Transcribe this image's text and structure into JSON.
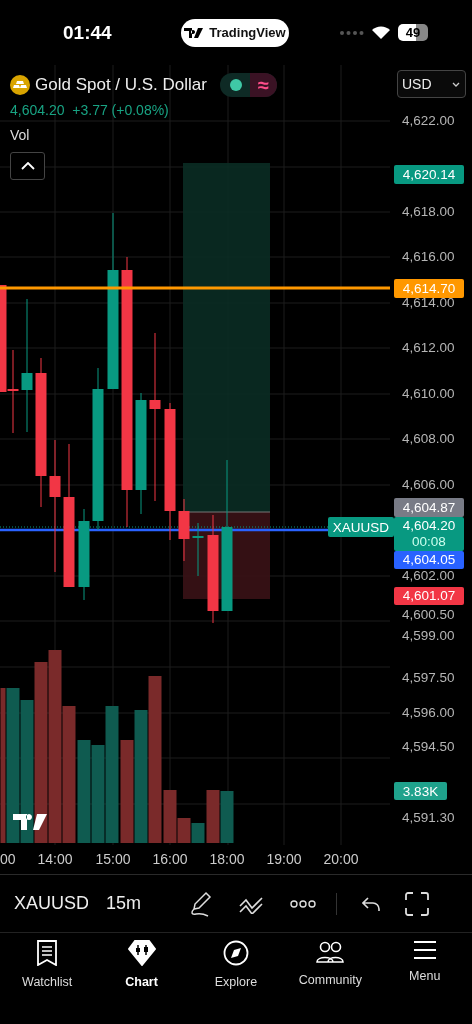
{
  "status_bar": {
    "time": "01:44",
    "app_pill": "TradingView",
    "battery": "49"
  },
  "symbol": {
    "name": "Gold Spot / U.S. Dollar",
    "price": "4,604.20",
    "change": "+3.77 (+0.08%)",
    "indicator_toggle": "≈"
  },
  "currency": "USD",
  "indicator": "Vol",
  "price_axis": {
    "ticks": [
      "4,622.00",
      "4,618.00",
      "4,616.00",
      "4,614.00",
      "4,612.00",
      "4,610.00",
      "4,608.00",
      "4,606.00",
      "4,602.00",
      "4,600.50",
      "4,599.00",
      "4,597.50",
      "4,596.00",
      "4,594.50",
      "4,591.30"
    ],
    "markers": [
      {
        "label": "4,620.14",
        "color": "#089981"
      },
      {
        "label": "4,614.70",
        "color": "#ff9800"
      },
      {
        "label": "4,604.87",
        "color": "#787b86"
      },
      {
        "label": "4,604.20",
        "sub": "00:08",
        "color": "#089981"
      },
      {
        "label": "4,604.05",
        "color": "#2962ff"
      },
      {
        "label": "4,601.07",
        "color": "#f23645"
      }
    ],
    "symbol_tag": "XAUUSD",
    "volume_badge": "3.83K"
  },
  "time_axis": [
    "00",
    "14:00",
    "15:00",
    "16:00",
    "18:00",
    "19:00",
    "20:00"
  ],
  "toolbar": {
    "symbol": "XAUUSD",
    "interval": "15m"
  },
  "nav": [
    {
      "kind": "watchlist",
      "label": "Watchlist",
      "selected": false
    },
    {
      "kind": "chart",
      "label": "Chart",
      "selected": true
    },
    {
      "kind": "explore",
      "label": "Explore",
      "selected": false
    },
    {
      "kind": "community",
      "label": "Community",
      "selected": false
    },
    {
      "kind": "menu",
      "label": "Menu",
      "selected": false
    }
  ]
}
